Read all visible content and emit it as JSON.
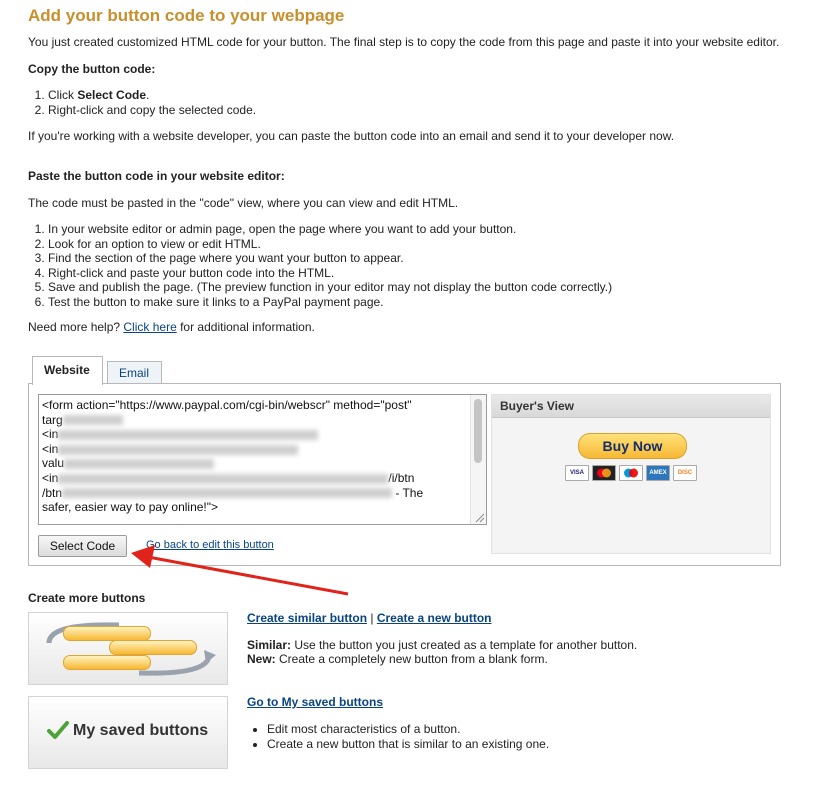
{
  "header": {
    "title": "Add your button code to your webpage"
  },
  "intro": "You just created customized HTML code for your button. The final step is to copy the code from this page and paste it into your website editor.",
  "copy_section": {
    "heading": "Copy the button code:",
    "step1_prefix": "Click ",
    "step1_bold": "Select Code",
    "step1_suffix": ".",
    "step2": "Right-click and copy the selected code."
  },
  "developer_note": "If you're working with a website developer, you can paste the button code into an email and send it to your developer now.",
  "paste_section": {
    "heading": "Paste the button code in your website editor:",
    "intro": "The code must be pasted in the \"code\" view, where you can view and edit HTML.",
    "steps": [
      "In your website editor or admin page, open the page where you want to add your button.",
      "Look for an option to view or edit HTML.",
      "Find the section of the page where you want your button to appear.",
      "Right-click and paste your button code into the HTML.",
      "Save and publish the page. (The preview function in your editor may not display the button code correctly.)",
      "Test the button to make sure it links to a PayPal payment page."
    ]
  },
  "help": {
    "prefix": "Need more help? ",
    "link": "Click here",
    "suffix": " for additional information."
  },
  "tabs": {
    "website": "Website",
    "email": "Email"
  },
  "code": {
    "line1": "<form action=\"https://www.paypal.com/cgi-bin/webscr\" method=\"post\"",
    "line2": "targ",
    "line3": "<in",
    "line4": "<in",
    "line5": "valu",
    "line6a": "<in",
    "line6b": "/i/btn",
    "line7a": "/btn",
    "line7b": "- The",
    "line8": "safer, easier way to pay online!\">"
  },
  "actions": {
    "select_code": "Select Code",
    "go_back": "Go back to edit this button"
  },
  "buyer_view": {
    "title": "Buyer's View",
    "buy_now": "Buy Now",
    "cards": [
      "VISA",
      "MC",
      "MAESTRO",
      "AMEX",
      "DISCOVER"
    ]
  },
  "more_buttons": {
    "heading": "Create more buttons",
    "link_similar": "Create similar button",
    "separator": " | ",
    "link_new": "Create a new button",
    "similar_label": "Similar:",
    "similar_text": " Use the button you just created as a template for another button.",
    "new_label": "New:",
    "new_text": " Create a completely new button from a blank form."
  },
  "saved_buttons": {
    "image_label": "My saved buttons",
    "link": "Go to My saved buttons",
    "bullets": [
      "Edit most characteristics of a button.",
      "Create a new button that is similar to an existing one."
    ]
  },
  "colors": {
    "title": "#c98f2c",
    "link": "#084482",
    "arrow": "#e0231b",
    "buy_now": "#f7b834"
  }
}
